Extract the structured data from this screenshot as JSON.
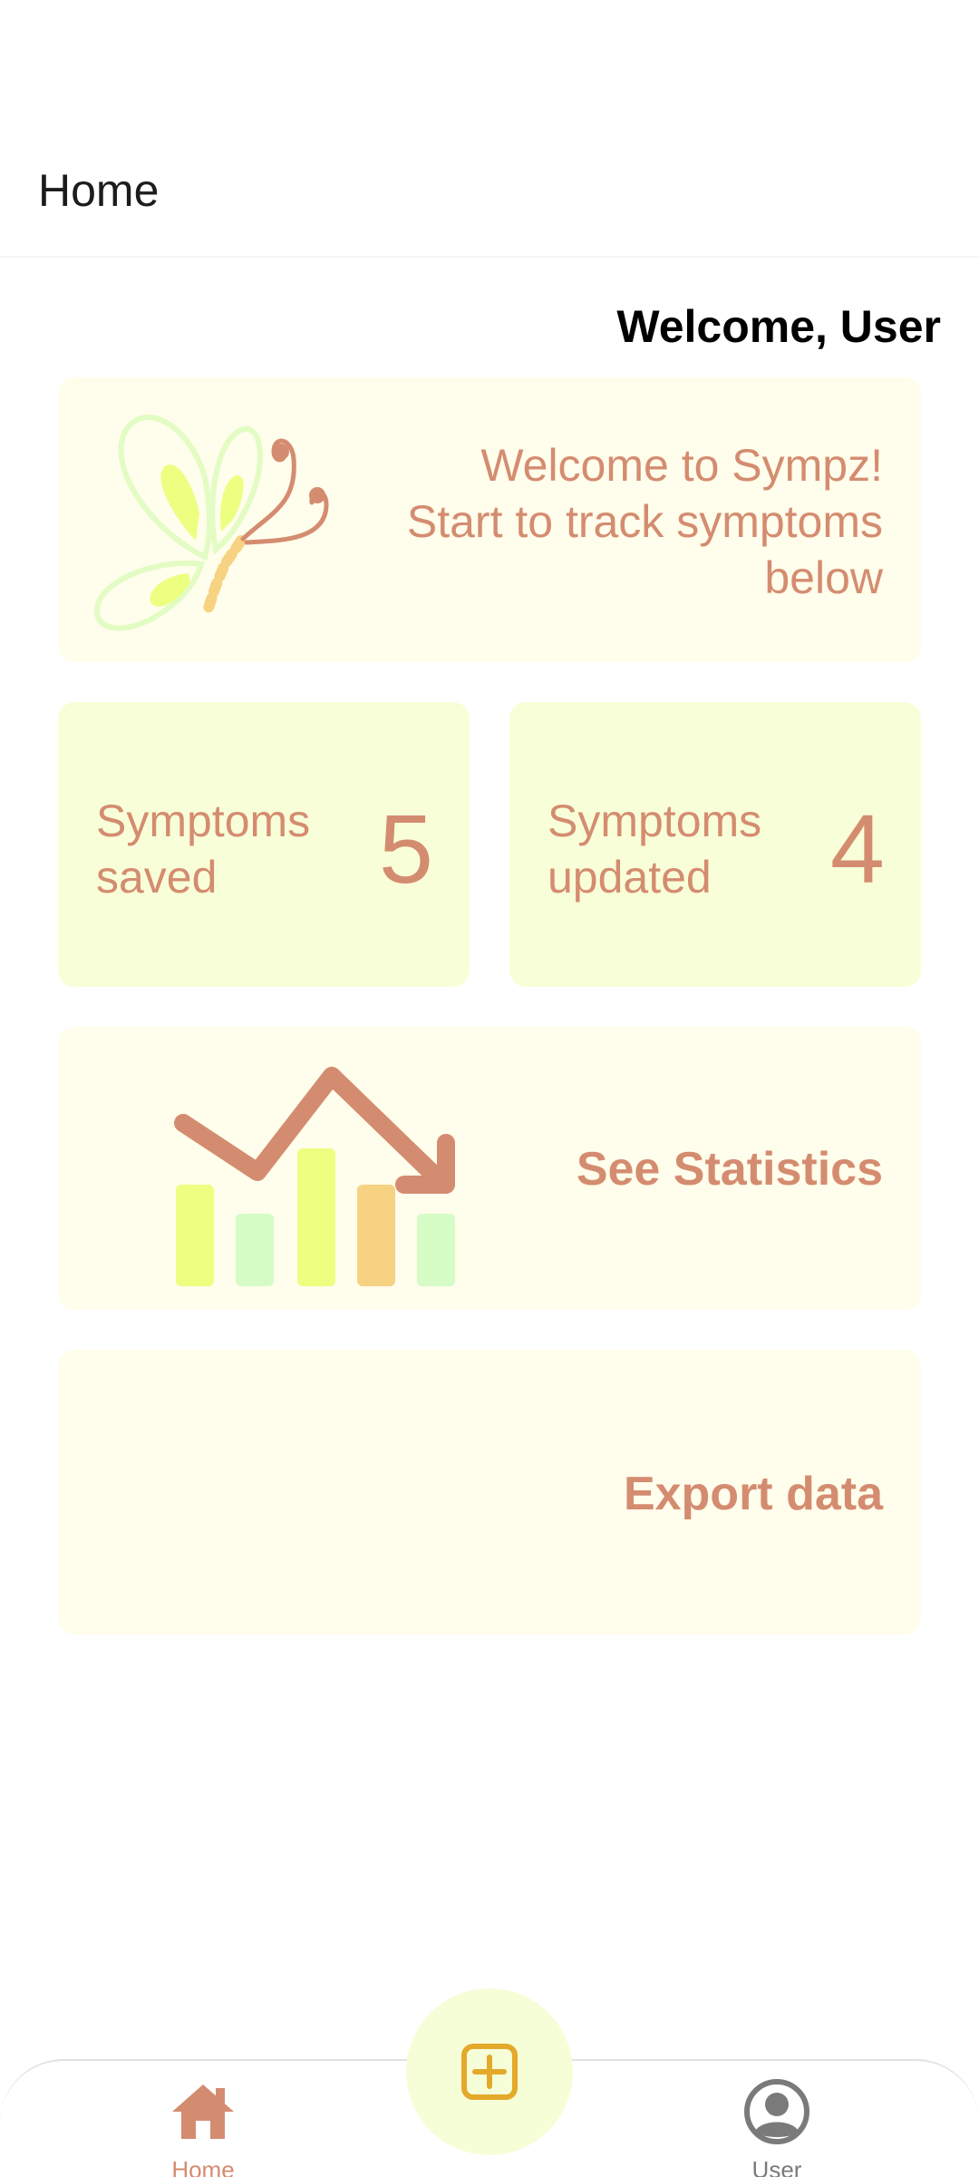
{
  "app_bar": {
    "title": "Home"
  },
  "greeting": "Welcome, User",
  "intro_card": {
    "lines": [
      "Welcome to Sympz!",
      "Start to track symptoms",
      "below"
    ],
    "icon": "butterfly-logo-icon"
  },
  "stats": {
    "saved": {
      "label_lines": [
        "Symptoms",
        "saved"
      ],
      "value": "5"
    },
    "updated": {
      "label_lines": [
        "Symptoms",
        "updated"
      ],
      "value": "4"
    }
  },
  "statistics_card": {
    "label": "See Statistics",
    "icon": "trend-chart-icon"
  },
  "export_card": {
    "label": "Export data"
  },
  "bottom_nav": {
    "home_label": "Home",
    "user_label": "User",
    "home_icon": "home-icon",
    "user_icon": "user-avatar-icon",
    "fab_icon": "add-square-icon"
  },
  "colors": {
    "accent_text": "#d48c70",
    "card_cream": "#fffdeb",
    "card_lime": "#f8ffd8",
    "fab_bg": "#f6fed8",
    "fab_icon": "#e4a92a",
    "bar_yellow": "#ecff80",
    "bar_green": "#d6fcc6",
    "bar_orange": "#f6d282"
  }
}
